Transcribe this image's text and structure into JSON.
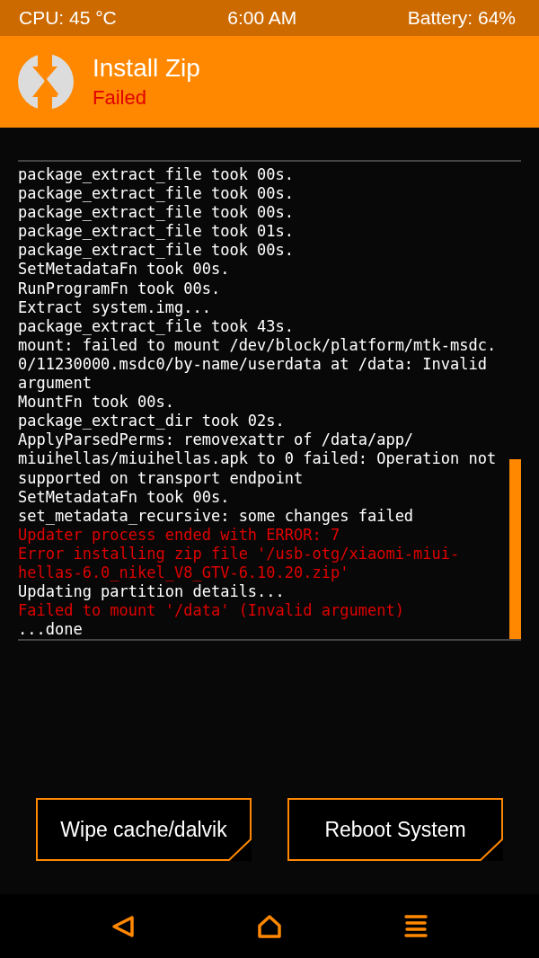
{
  "status_bar": {
    "cpu": "CPU: 45 °C",
    "time": "6:00 AM",
    "battery": "Battery: 64%"
  },
  "header": {
    "title": "Install Zip",
    "status": "Failed"
  },
  "log": [
    {
      "text": "package_extract_file took 00s.",
      "kind": "info"
    },
    {
      "text": "package_extract_file took 00s.",
      "kind": "info"
    },
    {
      "text": "package_extract_file took 00s.",
      "kind": "info"
    },
    {
      "text": "package_extract_file took 01s.",
      "kind": "info"
    },
    {
      "text": "package_extract_file took 00s.",
      "kind": "info"
    },
    {
      "text": "SetMetadataFn took 00s.",
      "kind": "info"
    },
    {
      "text": "RunProgramFn took 00s.",
      "kind": "info"
    },
    {
      "text": "Extract system.img...",
      "kind": "info"
    },
    {
      "text": "package_extract_file took 43s.",
      "kind": "info"
    },
    {
      "text": "mount: failed to mount /dev/block/platform/mtk-msdc.",
      "kind": "info"
    },
    {
      "text": "0/11230000.msdc0/by-name/userdata at /data: Invalid",
      "kind": "info"
    },
    {
      "text": "argument",
      "kind": "info"
    },
    {
      "text": "MountFn took 00s.",
      "kind": "info"
    },
    {
      "text": "package_extract_dir took 02s.",
      "kind": "info"
    },
    {
      "text": "ApplyParsedPerms: removexattr of /data/app/",
      "kind": "info"
    },
    {
      "text": "miuihellas/miuihellas.apk to 0 failed: Operation not",
      "kind": "info"
    },
    {
      "text": "supported on transport endpoint",
      "kind": "info"
    },
    {
      "text": "SetMetadataFn took 00s.",
      "kind": "info"
    },
    {
      "text": "set_metadata_recursive: some changes failed",
      "kind": "info"
    },
    {
      "text": "Updater process ended with ERROR: 7",
      "kind": "error"
    },
    {
      "text": "Error installing zip file '/usb-otg/xiaomi-miui-",
      "kind": "error"
    },
    {
      "text": "hellas-6.0_nikel_V8_GTV-6.10.20.zip'",
      "kind": "error"
    },
    {
      "text": "Updating partition details...",
      "kind": "info"
    },
    {
      "text": "Failed to mount '/data' (Invalid argument)",
      "kind": "error"
    },
    {
      "text": "...done",
      "kind": "info"
    }
  ],
  "buttons": [
    "Wipe cache/dalvik",
    "Reboot System"
  ]
}
